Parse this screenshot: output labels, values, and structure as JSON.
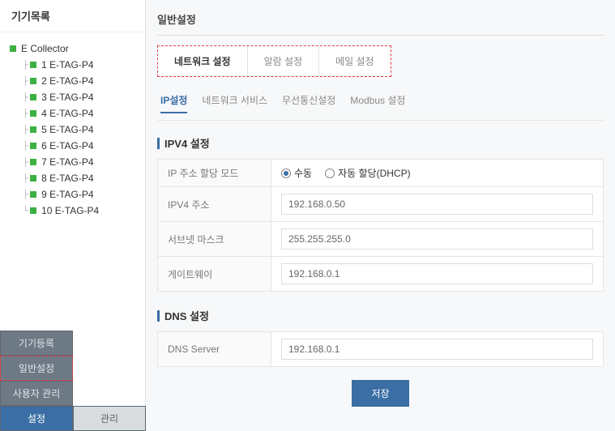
{
  "sidebar": {
    "header": "기기목록",
    "root": "E Collector",
    "items": [
      {
        "label": "1 E-TAG-P4"
      },
      {
        "label": "2 E-TAG-P4"
      },
      {
        "label": "3 E-TAG-P4"
      },
      {
        "label": "4 E-TAG-P4"
      },
      {
        "label": "5 E-TAG-P4"
      },
      {
        "label": "6 E-TAG-P4"
      },
      {
        "label": "7 E-TAG-P4"
      },
      {
        "label": "8 E-TAG-P4"
      },
      {
        "label": "9 E-TAG-P4"
      },
      {
        "label": "10 E-TAG-P4"
      }
    ]
  },
  "bottom_nav": {
    "device_register": "기기등록",
    "general_settings": "일반설정",
    "user_mgmt": "사용자 관리",
    "settings": "설정",
    "manage": "관리"
  },
  "main": {
    "title": "일반설정",
    "top_tabs": [
      {
        "label": "네트워크 설정",
        "active": true
      },
      {
        "label": "알람 설정",
        "active": false
      },
      {
        "label": "메일 설정",
        "active": false
      }
    ],
    "sub_tabs": [
      {
        "label": "IP설정",
        "active": true
      },
      {
        "label": "네트워크 서비스",
        "active": false
      },
      {
        "label": "무선통신설정",
        "active": false
      },
      {
        "label": "Modbus 설정",
        "active": false
      }
    ],
    "ipv4": {
      "section_title": "IPV4 설정",
      "rows": {
        "mode_label": "IP 주소 할당 모드",
        "manual_label": "수동",
        "dhcp_label": "자동 할당(DHCP)",
        "addr_label": "IPV4 주소",
        "addr_value": "192.168.0.50",
        "subnet_label": "서브넷 마스크",
        "subnet_value": "255.255.255.0",
        "gateway_label": "게이트웨이",
        "gateway_value": "192.168.0.1"
      }
    },
    "dns": {
      "section_title": "DNS 설정",
      "server_label": "DNS Server",
      "server_value": "192.168.0.1"
    },
    "save_label": "저장"
  }
}
